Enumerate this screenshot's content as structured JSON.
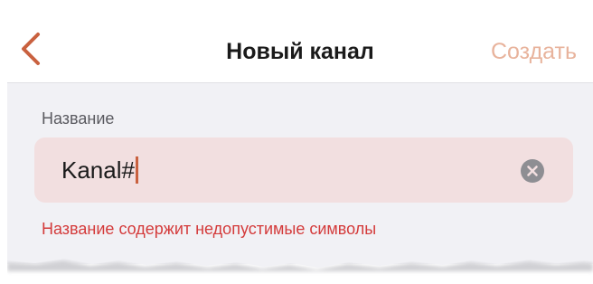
{
  "colors": {
    "accent": "#c9613f",
    "create_disabled": "#e8b39c",
    "input_error_bg": "#f2dfe0",
    "error_text": "#d43b3b",
    "form_bg": "#f1f1f5"
  },
  "nav": {
    "back_icon": "chevron-left-icon",
    "title": "Новый канал",
    "create_label": "Создать"
  },
  "form": {
    "name_label": "Название",
    "name_value": "Kanal#",
    "clear_icon": "clear-circle-icon",
    "error_message": "Название содержит недопустимые символы"
  }
}
